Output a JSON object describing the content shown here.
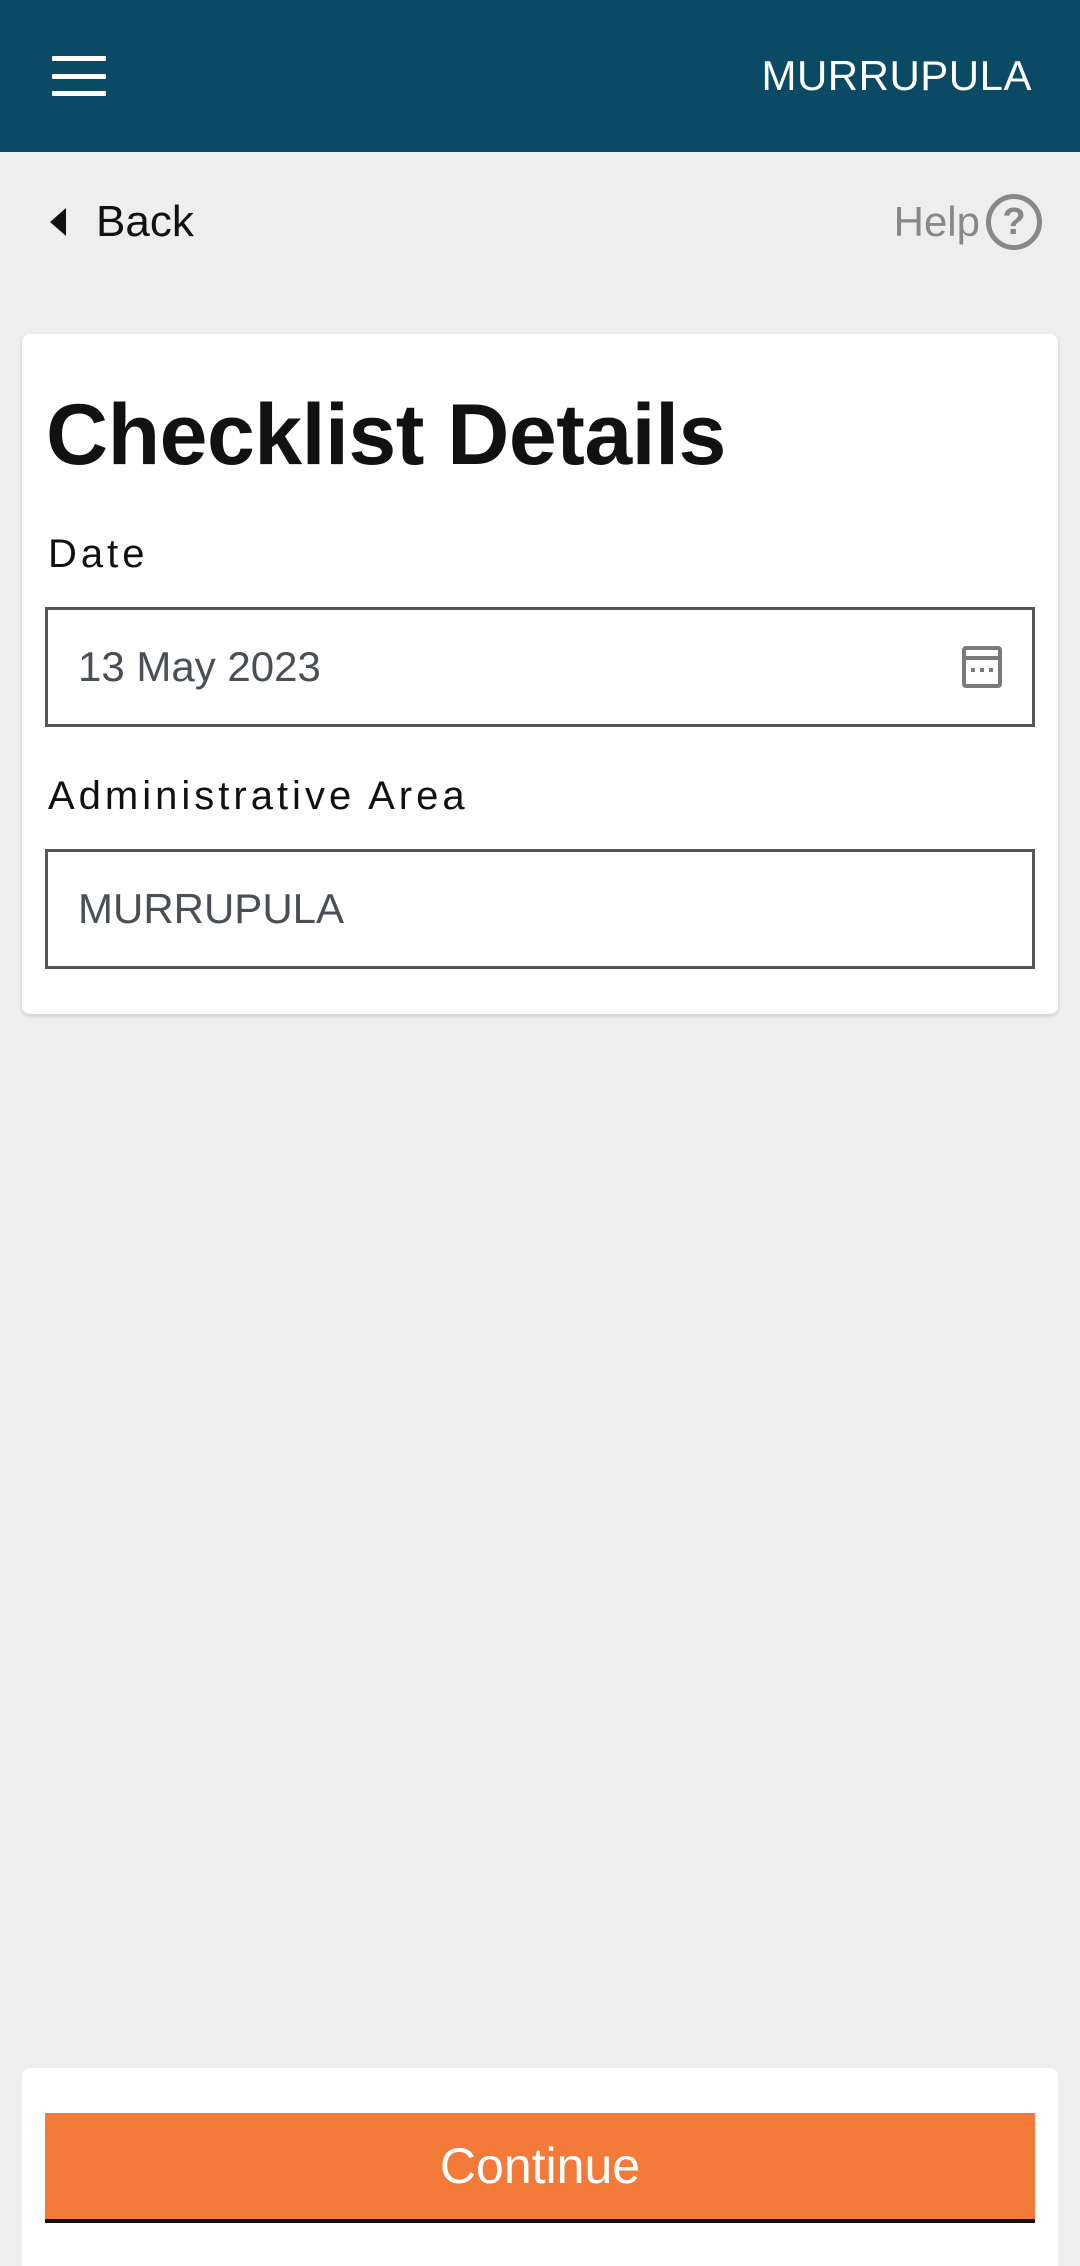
{
  "appbar": {
    "title": "MURRUPULA",
    "menu_icon": "hamburger-menu-icon",
    "bg_color": "#0b4a64"
  },
  "nav": {
    "back_label": "Back",
    "help_label": "Help",
    "help_glyph": "?"
  },
  "form": {
    "title": "Checklist Details",
    "date": {
      "label": "Date",
      "value": "13 May 2023",
      "icon": "calendar-icon"
    },
    "area": {
      "label": "Administrative Area",
      "value": "MURRUPULA"
    }
  },
  "footer": {
    "continue_label": "Continue",
    "accent_color": "#f47a3a"
  }
}
